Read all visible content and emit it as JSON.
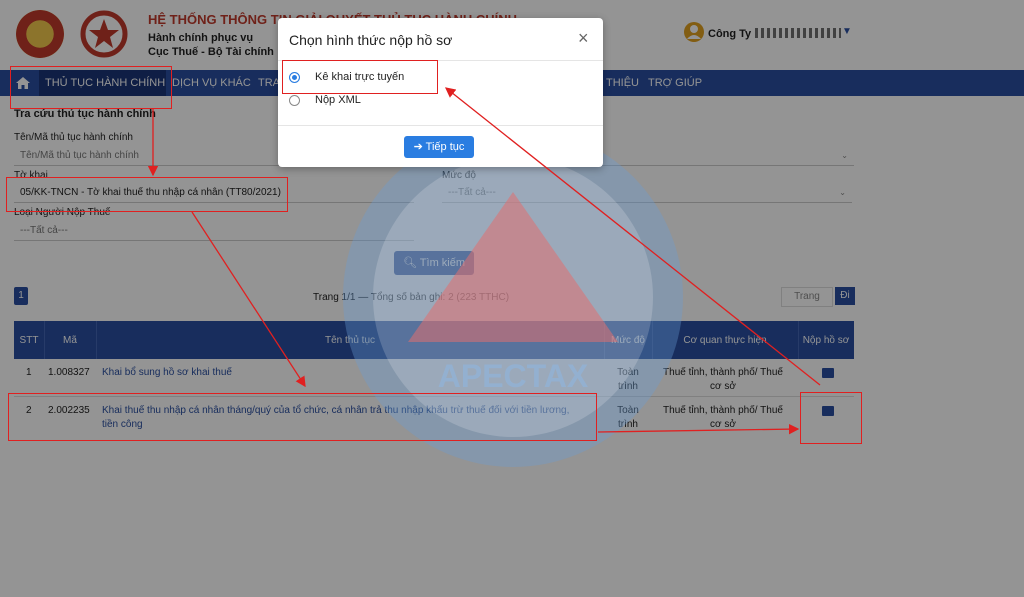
{
  "header": {
    "system_title": "HỆ THỐNG THÔNG TIN GIẢI QUYẾT THỦ TỤC HÀNH CHÍNH",
    "subtitle_line1": "Hành chính phục vụ",
    "subtitle_line2": "Cục Thuế - Bộ Tài chính",
    "user_label": "Công Ty"
  },
  "nav": {
    "items": [
      {
        "label": "THỦ TỤC HÀNH CHÍNH",
        "active": true
      },
      {
        "label": "DỊCH VỤ KHÁC"
      },
      {
        "label": "TRA"
      },
      {
        "label": "THIỆU"
      },
      {
        "label": "TRỢ GIÚP"
      }
    ]
  },
  "search": {
    "section_title": "Tra cứu thủ tục hành chính",
    "name_label": "Tên/Mã thủ tục hành chính",
    "name_placeholder": "Tên/Mã thủ tục hành chính",
    "form_label": "Tờ khai",
    "form_value": "05/KK-TNCN - Tờ khai thuế thu nhập cá nhân (TT80/2021)",
    "level_label": "Mức độ",
    "level_value": "---Tất cả---",
    "taxpayer_label": "Loại Người Nộp Thuế",
    "taxpayer_value": "---Tất cả---",
    "search_button": "Tìm kiếm"
  },
  "pagination": {
    "current_page": "1",
    "summary": "Trang 1/1 — Tổng số bản ghi: 2 (223 TTHC)",
    "page_placeholder": "Trang",
    "go_button": "Đi"
  },
  "table": {
    "headers": [
      "STT",
      "Mã",
      "Tên thủ tục",
      "Mức độ",
      "Cơ quan thực hiện",
      "Nộp hồ sơ"
    ],
    "rows": [
      {
        "stt": "1",
        "code": "1.008327",
        "name": "Khai bổ sung hồ sơ khai thuế",
        "level": "Toàn trình",
        "agency": "Thuế tỉnh, thành phố/ Thuế cơ sở"
      },
      {
        "stt": "2",
        "code": "2.002235",
        "name": "Khai thuế thu nhập cá nhân tháng/quý của tổ chức, cá nhân trả thu nhập khấu trừ thuế đối với tiền lương, tiền công",
        "level": "Toàn trình",
        "agency": "Thuế tỉnh, thành phố/ Thuế cơ sở"
      }
    ]
  },
  "modal": {
    "title": "Chọn hình thức nộp hồ sơ",
    "close": "×",
    "option_online": "Kê khai trực tuyến",
    "option_xml": "Nộp XML",
    "continue_button": "Tiếp tục"
  },
  "watermark": {
    "text": "APECTAX"
  },
  "colors": {
    "primary": "#2a4fa0",
    "annotation": "#e02020",
    "title_red": "#c0392b"
  }
}
